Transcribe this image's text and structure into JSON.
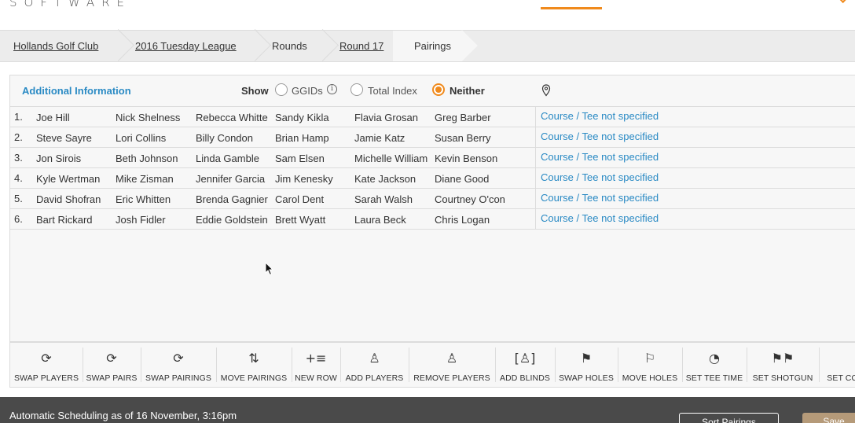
{
  "header": {
    "logo_text": "SOFTWARE"
  },
  "breadcrumb": [
    "Hollands Golf Club",
    "2016 Tuesday League",
    "Rounds",
    "Round 17",
    "Pairings"
  ],
  "info": {
    "title": "Additional Information",
    "show_label": "Show",
    "options": [
      "GGIDs",
      "Total Index",
      "Neither"
    ],
    "selected": "Neither",
    "info_icon": "i"
  },
  "pairings": [
    {
      "num": "1.",
      "players": [
        "Joe Hill",
        "Nick Shelness",
        "Rebecca Whitte",
        "Sandy Kikla",
        "Flavia Grosan",
        "Greg Barber"
      ],
      "course": "Course / Tee not specified"
    },
    {
      "num": "2.",
      "players": [
        "Steve Sayre",
        "Lori Collins",
        "Billy Condon",
        "Brian Hamp",
        "Jamie Katz",
        "Susan Berry"
      ],
      "course": "Course / Tee not specified"
    },
    {
      "num": "3.",
      "players": [
        "Jon Sirois",
        "Beth Johnson",
        "Linda Gamble",
        "Sam Elsen",
        "Michelle William",
        "Kevin Benson"
      ],
      "course": "Course / Tee not specified"
    },
    {
      "num": "4.",
      "players": [
        "Kyle Wertman",
        "Mike Zisman",
        "Jennifer Garcia",
        "Jim Kenesky",
        "Kate Jackson",
        "Diane Good"
      ],
      "course": "Course / Tee not specified"
    },
    {
      "num": "5.",
      "players": [
        "David Shofran",
        "Eric Whitten",
        "Brenda Gagnier",
        "Carol Dent",
        "Sarah Walsh",
        "Courtney O'con"
      ],
      "course": "Course / Tee not specified"
    },
    {
      "num": "6.",
      "players": [
        "Bart Rickard",
        "Josh Fidler",
        "Eddie Goldstein",
        "Brett Wyatt",
        "Laura Beck",
        "Chris Logan"
      ],
      "course": "Course / Tee not specified"
    }
  ],
  "toolbar": [
    {
      "label": "SWAP PLAYERS",
      "icon": "swap-players-icon",
      "glyph": "⟳"
    },
    {
      "label": "SWAP PAIRS",
      "icon": "swap-pairs-icon",
      "glyph": "⟳"
    },
    {
      "label": "SWAP PAIRINGS",
      "icon": "swap-pairings-icon",
      "glyph": "⟳"
    },
    {
      "label": "MOVE PAIRINGS",
      "icon": "move-pairings-icon",
      "glyph": "⇅"
    },
    {
      "label": "NEW ROW",
      "icon": "new-row-icon",
      "glyph": "+≡"
    },
    {
      "label": "ADD PLAYERS",
      "icon": "add-players-icon",
      "glyph": "♙"
    },
    {
      "label": "REMOVE PLAYERS",
      "icon": "remove-players-icon",
      "glyph": "♙"
    },
    {
      "label": "ADD BLINDS",
      "icon": "add-blinds-icon",
      "glyph": "[♙]"
    },
    {
      "label": "SWAP HOLES",
      "icon": "swap-holes-icon",
      "glyph": "⚑"
    },
    {
      "label": "MOVE HOLES",
      "icon": "move-holes-icon",
      "glyph": "⚐"
    },
    {
      "label": "SET TEE TIME",
      "icon": "clock-icon",
      "glyph": "◔"
    },
    {
      "label": "SET SHOTGUN",
      "icon": "checkered-flags-icon",
      "glyph": "⚑⚑"
    },
    {
      "label": "SET CO",
      "icon": "set-course-icon",
      "glyph": ""
    }
  ],
  "footer": {
    "text": "Automatic Scheduling as of 16 November, 3:16pm",
    "button1": "Sort Pairings",
    "button2": "Save"
  }
}
